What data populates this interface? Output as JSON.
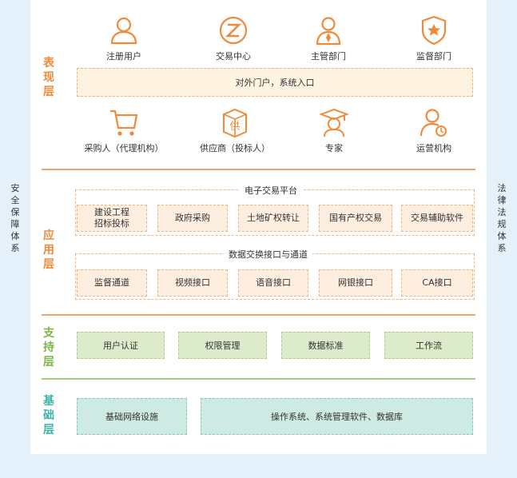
{
  "side_left": "安全保障体系",
  "side_right": "法律法规体系",
  "layers": {
    "presentation": "表现层",
    "application": "应用层",
    "support": "支持层",
    "foundation": "基础层"
  },
  "presentation": {
    "top_icons": [
      {
        "label": "注册用户",
        "icon": "user-icon"
      },
      {
        "label": "交易中心",
        "icon": "exchange-z-icon"
      },
      {
        "label": "主管部门",
        "icon": "manager-tie-icon"
      },
      {
        "label": "监督部门",
        "icon": "shield-star-icon"
      }
    ],
    "portal": "对外门户，系统入口",
    "bottom_icons": [
      {
        "label": "采购人（代理机构）",
        "icon": "shopping-cart-icon"
      },
      {
        "label": "供应商（投标人）",
        "icon": "supplier-box-icon"
      },
      {
        "label": "专家",
        "icon": "graduate-cap-icon"
      },
      {
        "label": "运营机构",
        "icon": "operator-icon"
      }
    ]
  },
  "application": {
    "platform_label": "电子交易平台",
    "platform_items": [
      "建设工程\n招标投标",
      "政府采购",
      "土地矿权转让",
      "国有产权交易",
      "交易辅助软件"
    ],
    "interface_label": "数据交换接口与通道",
    "interface_items": [
      "监督通道",
      "视频接口",
      "语音接口",
      "网银接口",
      "CA接口"
    ]
  },
  "support": {
    "items": [
      "用户认证",
      "权限管理",
      "数据标准",
      "工作流"
    ]
  },
  "foundation": {
    "items": [
      "基础网络设施",
      "操作系统、系统管理软件、数据库"
    ]
  },
  "colors": {
    "orange": "#f08a3a",
    "green": "#7ab648",
    "teal": "#39b4a7",
    "side_bg": "#e4f1fb"
  }
}
